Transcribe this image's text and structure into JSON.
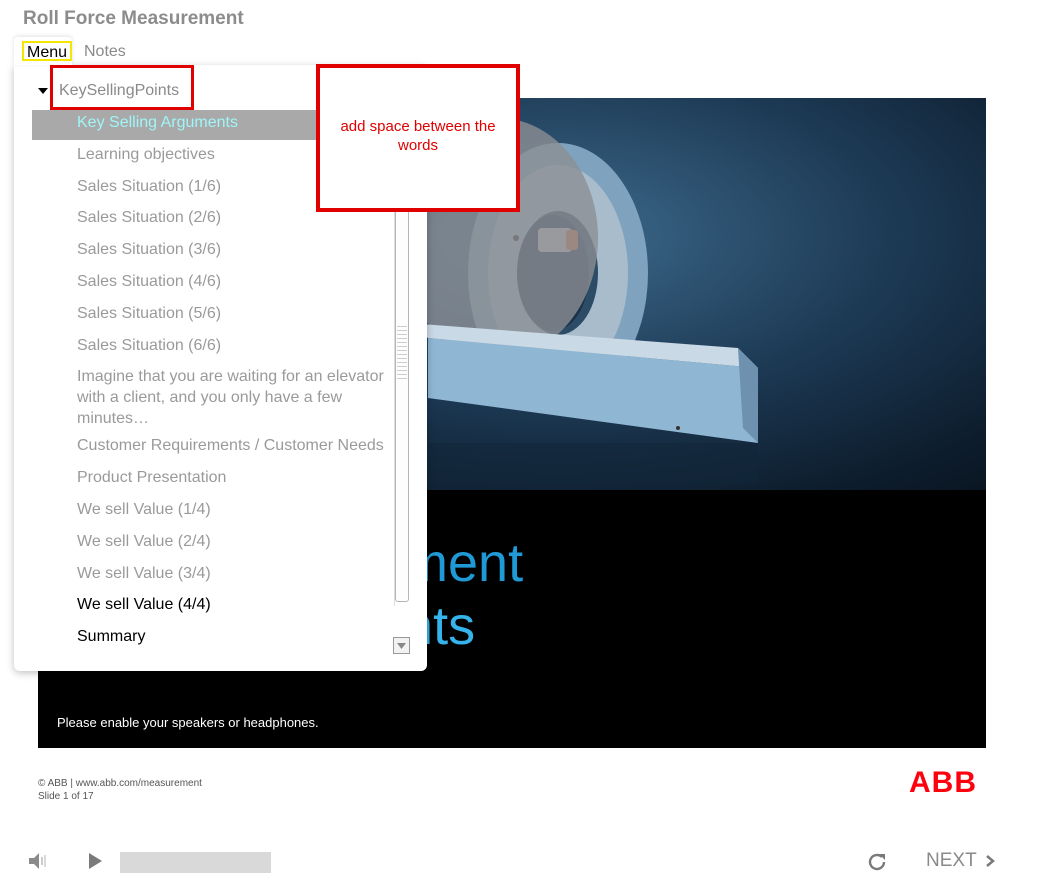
{
  "app": {
    "title": "Roll Force Measurement"
  },
  "tabs": {
    "menu": "Menu",
    "notes": "Notes"
  },
  "menu": {
    "root_label": "KeySellingPoints",
    "items": [
      {
        "label": "Key Selling Arguments",
        "state": "active"
      },
      {
        "label": "Learning objectives",
        "state": "normal"
      },
      {
        "label": "Sales Situation (1/6)",
        "state": "normal"
      },
      {
        "label": "Sales Situation (2/6)",
        "state": "normal"
      },
      {
        "label": "Sales Situation (3/6)",
        "state": "normal"
      },
      {
        "label": "Sales Situation (4/6)",
        "state": "normal"
      },
      {
        "label": "Sales Situation (5/6)",
        "state": "normal"
      },
      {
        "label": "Sales Situation (6/6)",
        "state": "normal"
      },
      {
        "label": "Imagine that you are waiting for an elevator with a client, and you only have a few minutes…",
        "state": "normal"
      },
      {
        "label": "Customer Requirements / Customer Needs",
        "state": "normal"
      },
      {
        "label": "Product Presentation",
        "state": "normal"
      },
      {
        "label": "We sell Value (1/4)",
        "state": "normal"
      },
      {
        "label": "We sell Value (2/4)",
        "state": "normal"
      },
      {
        "label": "We sell Value (3/4)",
        "state": "normal"
      },
      {
        "label": "We sell Value (4/4)",
        "state": "visited"
      },
      {
        "label": "Summary",
        "state": "visited"
      }
    ]
  },
  "annotation": {
    "comment": "add space between the words"
  },
  "slide": {
    "headline_line1": "surement",
    "headline_line2": "uments",
    "audio_note": "Please enable your speakers or headphones."
  },
  "footer": {
    "copyright": "© ABB | www.abb.com/measurement",
    "slide_counter": "Slide 1 of 17",
    "logo": "ABB"
  },
  "controls": {
    "next_label": "NEXT",
    "icons": [
      "speaker-icon",
      "play-icon",
      "replay-icon",
      "chevron-right-icon"
    ]
  },
  "colors": {
    "accent_cyan": "#9ff5f8",
    "headline_blue": "#1f9ad6",
    "annotation_red": "#e00000",
    "abb_red": "#ff000f",
    "highlight_gray": "#a9a9a9"
  }
}
